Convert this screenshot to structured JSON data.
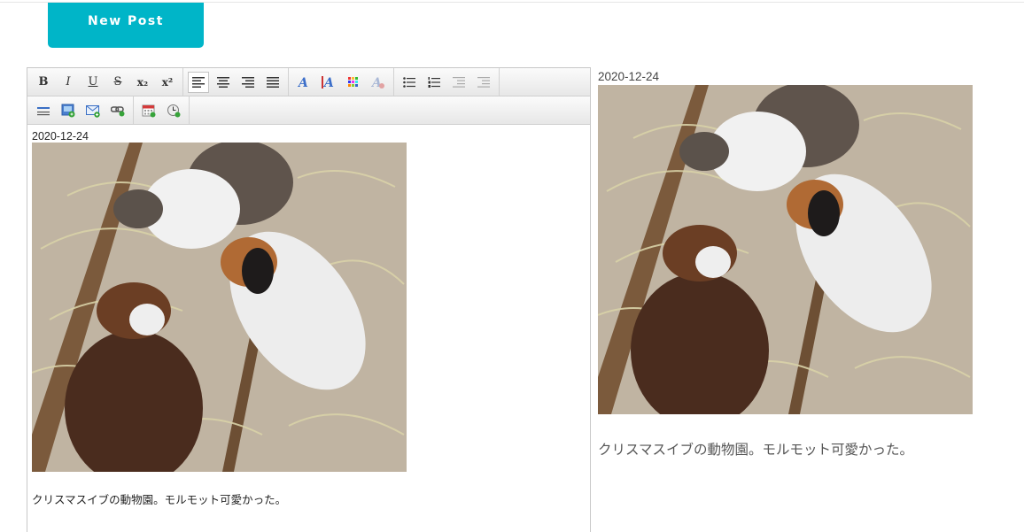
{
  "header": {
    "new_post_label": "New Post"
  },
  "toolbar": {
    "row1": [
      {
        "name": "bold",
        "glyph": "B"
      },
      {
        "name": "italic",
        "glyph": "I"
      },
      {
        "name": "underline",
        "glyph": "U"
      },
      {
        "name": "strikethrough",
        "glyph": "S"
      },
      {
        "name": "subscript",
        "glyph": "x₂"
      },
      {
        "name": "superscript",
        "glyph": "x²"
      }
    ]
  },
  "editor": {
    "date": "2020-12-24",
    "caption": "クリスマスイブの動物園。モルモット可愛かった。"
  },
  "preview": {
    "date": "2020-12-24",
    "caption": "クリスマスイブの動物園。モルモット可愛かった。"
  },
  "colors": {
    "accent": "#00b5c8"
  },
  "photo": {
    "subject": "three guinea pigs eating hay"
  }
}
